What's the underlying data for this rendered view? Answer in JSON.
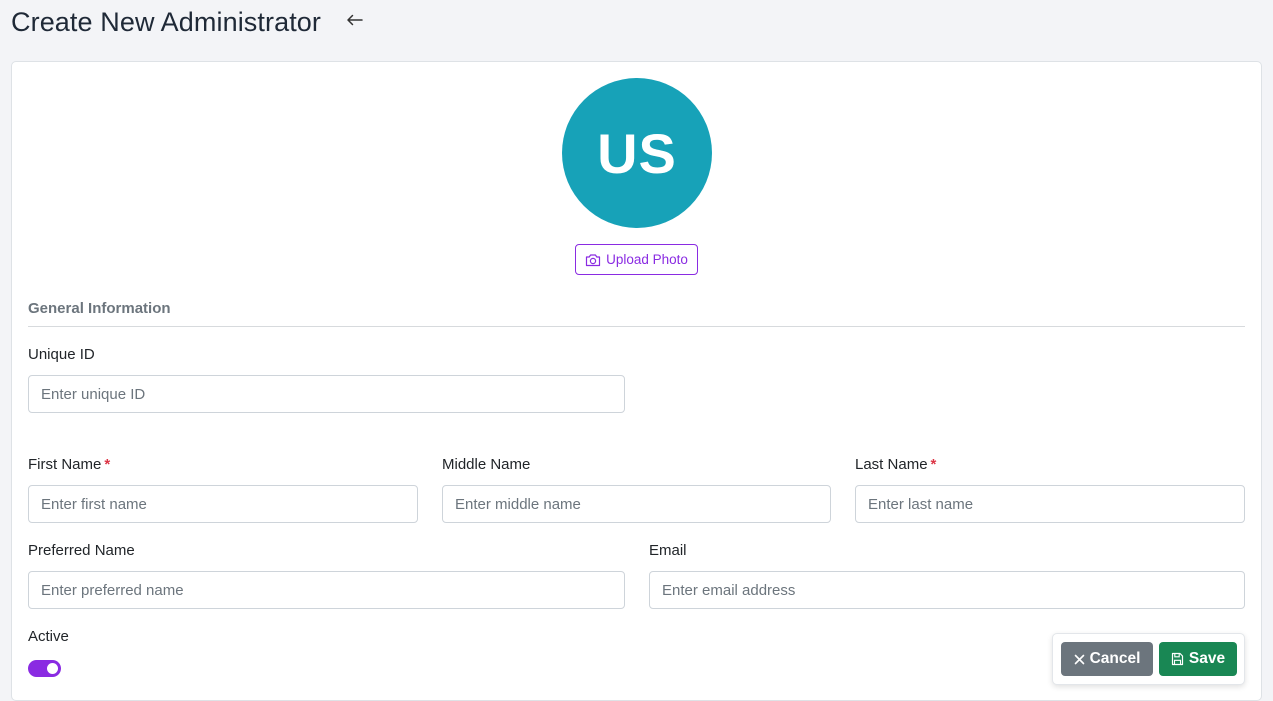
{
  "header": {
    "title": "Create New Administrator",
    "back_icon": "arrow-left-icon"
  },
  "avatar": {
    "initials": "US",
    "color": "#17a2b8"
  },
  "upload": {
    "label": "Upload Photo",
    "icon": "camera-icon",
    "color": "#8a2be2"
  },
  "section": {
    "title": "General Information"
  },
  "fields": {
    "unique_id": {
      "label": "Unique ID",
      "placeholder": "Enter unique ID",
      "value": ""
    },
    "first_name": {
      "label": "First Name",
      "required": "*",
      "placeholder": "Enter first name",
      "value": ""
    },
    "middle_name": {
      "label": "Middle Name",
      "placeholder": "Enter middle name",
      "value": ""
    },
    "last_name": {
      "label": "Last Name",
      "required": "*",
      "placeholder": "Enter last name",
      "value": ""
    },
    "preferred_name": {
      "label": "Preferred Name",
      "placeholder": "Enter preferred name",
      "value": ""
    },
    "email": {
      "label": "Email",
      "placeholder": "Enter email address",
      "value": ""
    },
    "active": {
      "label": "Active",
      "checked": true,
      "color": "#8a2be2"
    }
  },
  "actions": {
    "cancel": {
      "label": "Cancel",
      "icon": "close-icon",
      "color": "#6c757d"
    },
    "save": {
      "label": "Save",
      "icon": "save-icon",
      "color": "#198754"
    }
  }
}
